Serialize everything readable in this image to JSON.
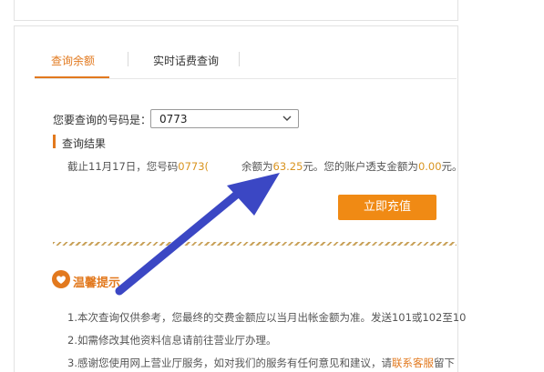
{
  "tabs": [
    {
      "label": "查询余额"
    },
    {
      "label": "实时话费查询"
    }
  ],
  "query": {
    "label": "您要查询的号码是：",
    "phone_value": "0773"
  },
  "result": {
    "title": "查询结果",
    "prefix": "截止11月17日，您号码",
    "phone_partial": "0773(",
    "balance_prefix": "余额为",
    "balance": "63.25",
    "yuan1": "元。您的账户透支金额为",
    "overdraft": "0.00",
    "yuan2": "元。"
  },
  "actions": {
    "recharge_label": "立即充值"
  },
  "tips": {
    "title": "温馨提示",
    "items": [
      "1.本次查询仅供参考，您最终的交费金额应以当月出帐金额为准。发送101或102至10",
      "2.如需修改其他资料信息请前往营业厅办理。",
      "3.感谢您使用网上营业厅服务，如对我们的服务有任何意见和建议，请"
    ],
    "contact_link": "联系客服",
    "item3_tail": "留下"
  },
  "colors": {
    "accent": "#e2791e",
    "number": "#d9941f",
    "arrow": "#3b47c4",
    "button": "#f08a14"
  },
  "icons": {
    "tips_icon": "heart-icon",
    "select_chevron": "chevron-down-icon",
    "annotation": "arrow-annotation"
  }
}
